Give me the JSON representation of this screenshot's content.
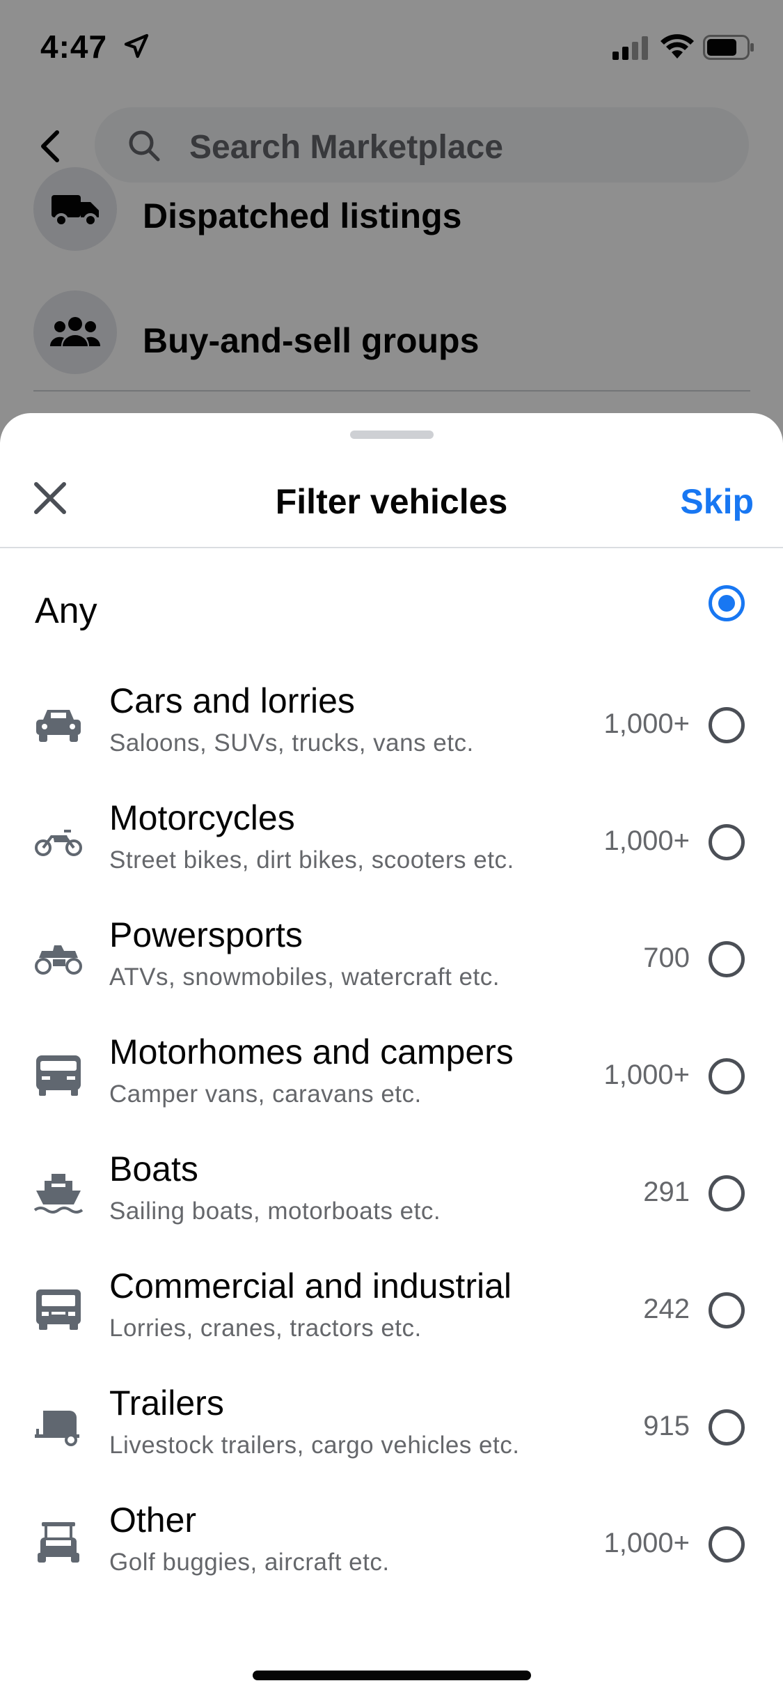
{
  "status_bar": {
    "time": "4:47"
  },
  "search": {
    "placeholder": "Search Marketplace"
  },
  "background_menu": [
    {
      "label": "Dispatched listings",
      "icon": "truck-icon"
    },
    {
      "label": "Buy-and-sell groups",
      "icon": "group-icon"
    }
  ],
  "sheet": {
    "title": "Filter vehicles",
    "skip_label": "Skip",
    "any_label": "Any",
    "any_selected": true,
    "options": [
      {
        "title": "Cars and lorries",
        "subtitle": "Saloons, SUVs, trucks, vans etc.",
        "count": "1,000+",
        "icon": "car-icon"
      },
      {
        "title": "Motorcycles",
        "subtitle": "Street bikes, dirt bikes, scooters etc.",
        "count": "1,000+",
        "icon": "motorcycle-icon"
      },
      {
        "title": "Powersports",
        "subtitle": "ATVs, snowmobiles, watercraft etc.",
        "count": "700",
        "icon": "atv-icon"
      },
      {
        "title": "Motorhomes and campers",
        "subtitle": "Camper vans, caravans etc.",
        "count": "1,000+",
        "icon": "camper-icon"
      },
      {
        "title": "Boats",
        "subtitle": "Sailing boats, motorboats etc.",
        "count": "291",
        "icon": "boat-icon"
      },
      {
        "title": "Commercial and industrial",
        "subtitle": "Lorries, cranes, tractors etc.",
        "count": "242",
        "icon": "lorry-icon"
      },
      {
        "title": "Trailers",
        "subtitle": "Livestock trailers, cargo vehicles etc.",
        "count": "915",
        "icon": "trailer-icon"
      },
      {
        "title": "Other",
        "subtitle": "Golf buggies, aircraft etc.",
        "count": "1,000+",
        "icon": "golf-cart-icon"
      }
    ]
  },
  "colors": {
    "accent": "#1877f2",
    "text_primary": "#050505",
    "text_secondary": "#65676b"
  }
}
